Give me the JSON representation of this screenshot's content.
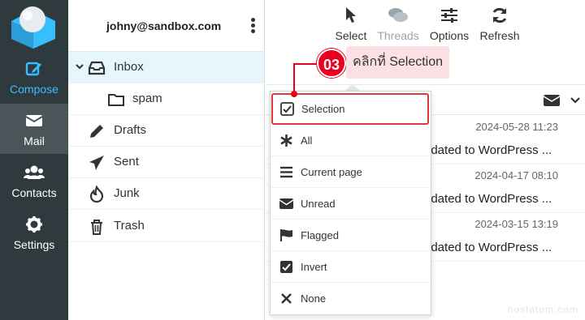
{
  "account": {
    "email": "johny@sandbox.com"
  },
  "rail": {
    "items": [
      {
        "label": "Compose",
        "icon": "compose-icon"
      },
      {
        "label": "Mail",
        "icon": "mail-icon"
      },
      {
        "label": "Contacts",
        "icon": "contacts-icon"
      },
      {
        "label": "Settings",
        "icon": "gear-icon"
      }
    ]
  },
  "folders": [
    {
      "label": "Inbox",
      "icon": "inbox-icon"
    },
    {
      "label": "spam",
      "icon": "folder-icon"
    },
    {
      "label": "Drafts",
      "icon": "pencil-icon"
    },
    {
      "label": "Sent",
      "icon": "paper-plane-icon"
    },
    {
      "label": "Junk",
      "icon": "fire-icon"
    },
    {
      "label": "Trash",
      "icon": "trash-icon"
    }
  ],
  "toolbar": {
    "select": "Select",
    "threads": "Threads",
    "options": "Options",
    "refresh": "Refresh"
  },
  "callout": {
    "step": "03",
    "text": "คลิกที่ Selection"
  },
  "dropdown": {
    "items": [
      {
        "label": "Selection",
        "icon": "checkbox-icon"
      },
      {
        "label": "All",
        "icon": "asterisk-icon"
      },
      {
        "label": "Current page",
        "icon": "list-icon"
      },
      {
        "label": "Unread",
        "icon": "envelope-icon"
      },
      {
        "label": "Flagged",
        "icon": "flag-icon"
      },
      {
        "label": "Invert",
        "icon": "checked-box-icon"
      },
      {
        "label": "None",
        "icon": "close-icon"
      }
    ]
  },
  "messages": [
    {
      "date": "2024-05-28 11:23",
      "subject": "odated to WordPress ..."
    },
    {
      "date": "2024-04-17 08:10",
      "subject": "odated to WordPress ..."
    },
    {
      "date": "2024-03-15 13:19",
      "subject": "odated to WordPress ..."
    }
  ],
  "watermark": "hostatom.com",
  "colors": {
    "rail": "#2f3a3f",
    "accent": "#37beff",
    "highlight": "#e23a3a",
    "badge": "#e8001c",
    "selected_folder": "#e7f5fc"
  }
}
